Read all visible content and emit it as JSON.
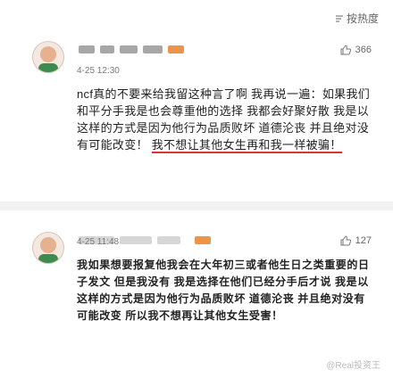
{
  "header": {
    "sort_label": "按热度"
  },
  "comments": [
    {
      "time": "4-25 12:30",
      "likes": "366",
      "text_plain": "ncf真的不要来给我留这种言了啊 我再说一遍：如果我们和平分手我是也会尊重他的选择 我都会好聚好散 我是以这样的方式是因为他行为品质败坏 道德沦丧 并且绝对没有可能改变！",
      "text_highlight": "我不想让其他女生再和我一样被骗！"
    },
    {
      "time": "4-25 11:48",
      "likes": "127",
      "text": "我如果想要报复他我会在大年初三或者他生日之类重要的日子发文 但是我没有 我是选择在他们已经分手后才说 我是以这样的方式是因为他行为品质败坏 道德沦丧 并且绝对没有可能改变 所以我不想再让其他女生受害！"
    }
  ],
  "watermark": "@Real投资王"
}
